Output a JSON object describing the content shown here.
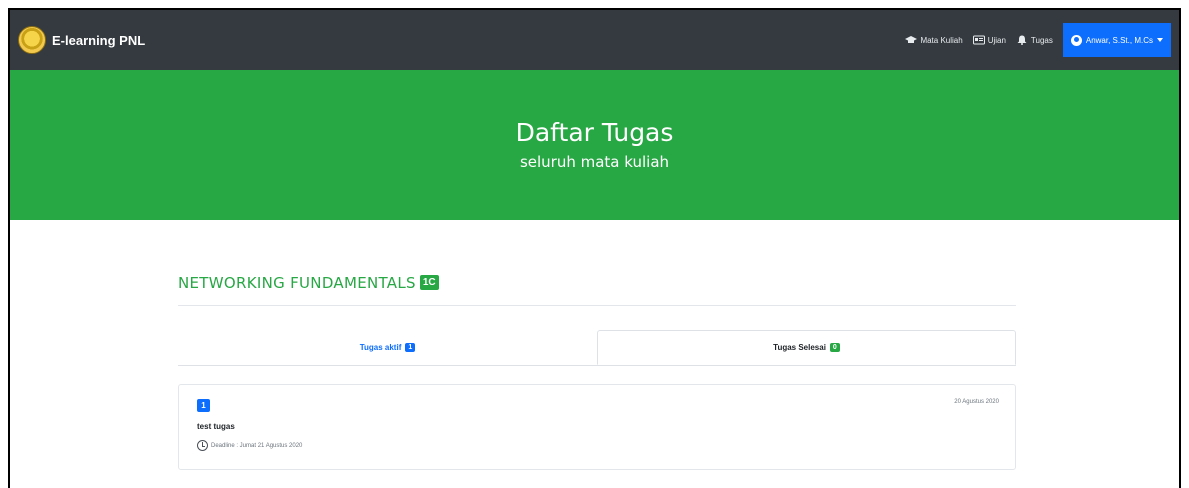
{
  "navbar": {
    "brand": "E-learning PNL",
    "links": [
      {
        "icon": "graduation-cap-icon",
        "label": "Mata Kuliah"
      },
      {
        "icon": "id-card-icon",
        "label": "Ujian"
      },
      {
        "icon": "bell-icon",
        "label": "Tugas"
      }
    ],
    "user": "Anwar, S.St., M.Cs"
  },
  "hero": {
    "title": "Daftar Tugas",
    "subtitle": "seluruh mata kuliah"
  },
  "course": {
    "name": "NETWORKING FUNDAMENTALS",
    "code": "1C"
  },
  "tabs": {
    "active_label": "Tugas aktif",
    "active_count": "1",
    "done_label": "Tugas Selesai",
    "done_count": "0"
  },
  "task": {
    "number": "1",
    "title": "test tugas",
    "date": "20 Agustus 2020",
    "deadline": "Deadline : Jumat 21 Agustus 2020"
  },
  "colors": {
    "navbar": "#343a40",
    "hero": "#28a745",
    "primary": "#0d6efd"
  }
}
